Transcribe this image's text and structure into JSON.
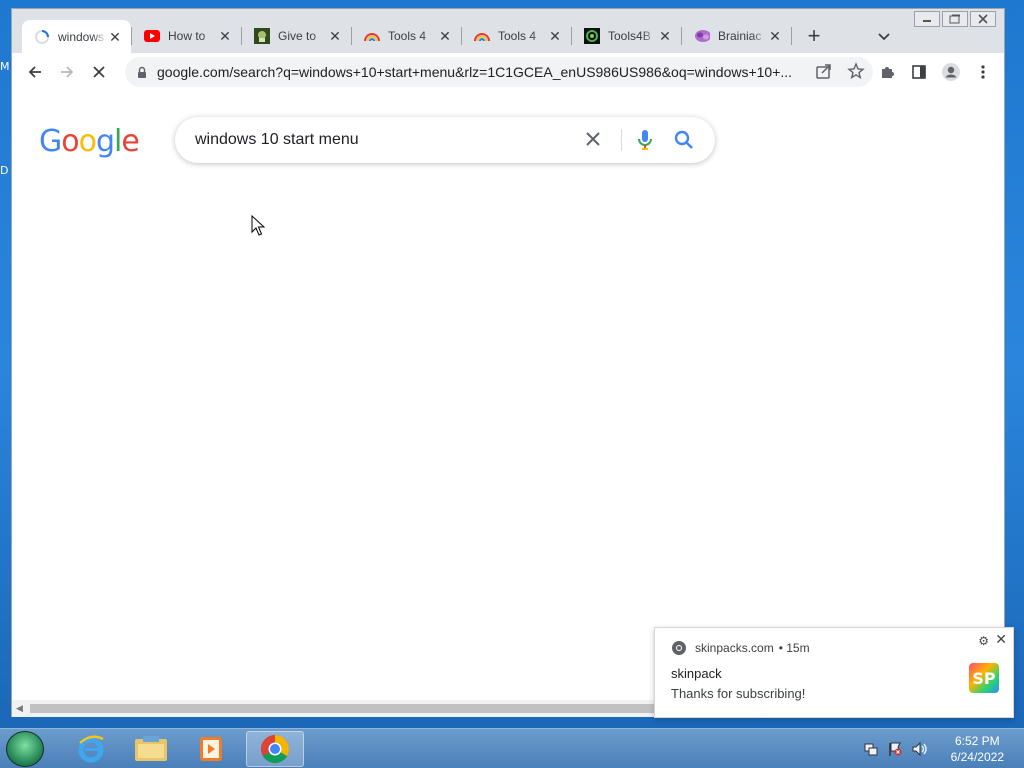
{
  "desktop": {
    "icon_letters": [
      "M",
      "D"
    ]
  },
  "browser": {
    "tabs": [
      {
        "title": "windows",
        "favicon": "loading-spinner-icon",
        "active": true
      },
      {
        "title": "How to",
        "favicon": "youtube-icon",
        "active": false
      },
      {
        "title": "Give to",
        "favicon": "give-favicon-icon",
        "active": false
      },
      {
        "title": "Tools 4",
        "favicon": "rainbow-favicon-icon",
        "active": false
      },
      {
        "title": "Tools 4",
        "favicon": "rainbow-favicon-icon",
        "active": false
      },
      {
        "title": "Tools4B",
        "favicon": "tools4b-favicon-icon",
        "active": false
      },
      {
        "title": "Brainiac",
        "favicon": "brainiac-favicon-icon",
        "active": false
      }
    ],
    "new_tab_label": "+",
    "url": "google.com/search?q=windows+10+start+menu&rlz=1C1GCEA_enUS986US986&oq=windows+10+..."
  },
  "search": {
    "logo": "Google",
    "query": "windows 10 start menu"
  },
  "notification": {
    "source": "skinpacks.com",
    "age": "• 15m",
    "title": "skinpack",
    "body": "Thanks for subscribing!",
    "badge": "SP"
  },
  "taskbar": {
    "time": "6:52 PM",
    "date": "6/24/2022"
  },
  "colors": {
    "google_blue": "#4285F4",
    "google_red": "#EA4335",
    "google_yellow": "#FBBC05",
    "google_green": "#34A853"
  }
}
